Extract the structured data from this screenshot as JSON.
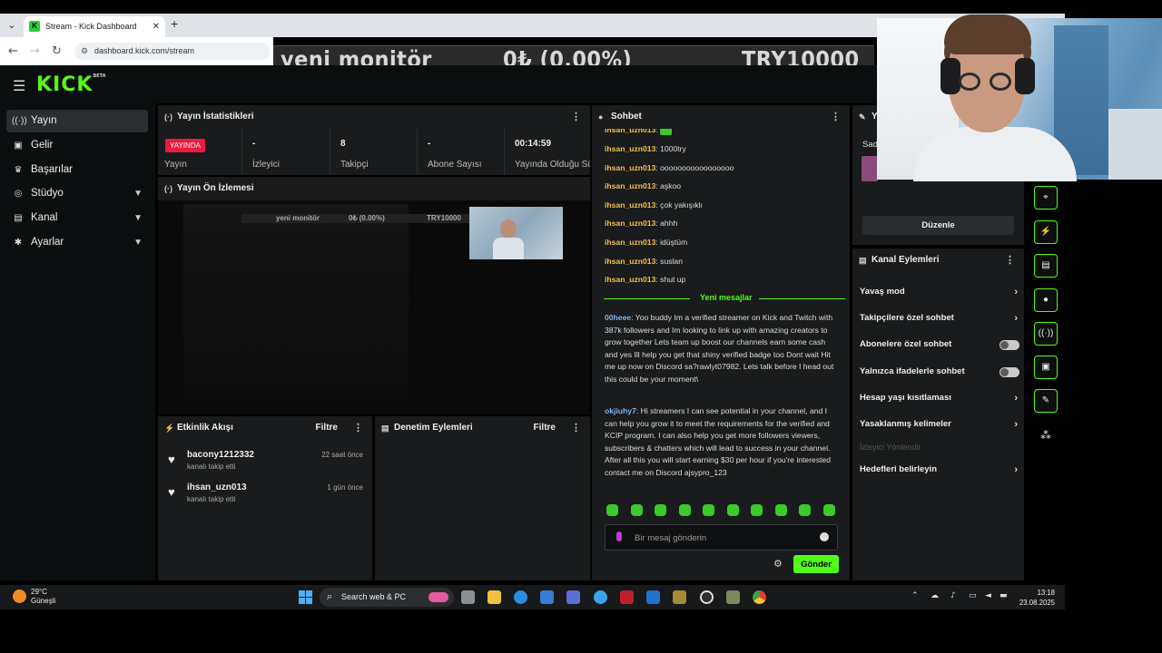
{
  "browser": {
    "tab_title": "Stream - Kick Dashboard",
    "favicon": "K",
    "url": "dashboard.kick.com/stream"
  },
  "ticker": {
    "name": "yeni monitör",
    "amount": "0₺ (0.00%)",
    "goal": "TRY10000"
  },
  "header": {
    "logo": "KICK",
    "logo_badge": "BETA"
  },
  "sidebar": {
    "items": [
      {
        "label": "Yayın",
        "icon": "broadcast-icon"
      },
      {
        "label": "Gelir",
        "icon": "wallet-icon"
      },
      {
        "label": "Başarılar",
        "icon": "trophy-icon"
      },
      {
        "label": "Stüdyo",
        "icon": "studio-icon"
      },
      {
        "label": "Kanal",
        "icon": "channel-icon"
      },
      {
        "label": "Ayarlar",
        "icon": "gear-icon"
      }
    ]
  },
  "stats": {
    "title": "Yayın İstatistikleri",
    "live_badge": "YAYINDA",
    "stream_label": "Yayın",
    "viewers_value": "-",
    "viewers_label": "İzleyici",
    "followers_value": "8",
    "followers_label": "Takipçi",
    "subs_value": "-",
    "subs_label": "Abone Sayısı",
    "duration_value": "00:14:59",
    "duration_label": "Yayında Olduğu Sü"
  },
  "preview": {
    "title": "Yayın Ön İzlemesi",
    "ticker_name": "yeni monitör",
    "ticker_amount": "0₺ (0.00%)",
    "ticker_goal": "TRY10000"
  },
  "events": {
    "title": "Etkinlik Akışı",
    "filter": "Filtre",
    "items": [
      {
        "user": "bacony1212332",
        "action": "kanalı takip etti",
        "time": "22 saat önce"
      },
      {
        "user": "ihsan_uzn013",
        "action": "kanalı takip etti",
        "time": "1 gün önce"
      }
    ]
  },
  "moderation": {
    "title": "Denetim Eylemleri",
    "filter": "Filtre"
  },
  "chat": {
    "title": "Sohbet",
    "messages": [
      {
        "user": "ihsan_uzn013",
        "text": ""
      },
      {
        "user": "ihsan_uzn013",
        "text": "1000try"
      },
      {
        "user": "ihsan_uzn013",
        "text": "ooooooooooooooooo"
      },
      {
        "user": "ihsan_uzn013",
        "text": "aşkoo"
      },
      {
        "user": "ihsan_uzn013",
        "text": "çok yakışıklı"
      },
      {
        "user": "ihsan_uzn013",
        "text": "ahhh"
      },
      {
        "user": "ihsan_uzn013",
        "text": "idüştüm"
      },
      {
        "user": "ihsan_uzn013",
        "text": "suslan"
      },
      {
        "user": "ihsan_uzn013",
        "text": "shut up"
      }
    ],
    "new_messages_label": "Yeni mesajlar",
    "new_messages": [
      {
        "user": "00heee",
        "text": "Yoo buddy Im a verified streamer on Kick and Twitch with 387k followers and Im looking to link up with amazing creators to grow together Lets team up boost our channels earn some cash and yes Ill help you get that shiny verified badge too Dont wait Hit me up now on Discord sa?rawlyt07982. Lets talk before I head out this could be your moment\\"
      },
      {
        "user": "okjiuhy7",
        "text": "Hi streamers I can see potential in your channel, and I can help you grow it to meet the requirements for the verified and KCIP program. I can also help you get more followers viewers, subscribers & chatters which will lead to success in your channel. After all this you will start earning $30 per hour if you're interested contact me on Discord ajsypro_123"
      }
    ],
    "input_placeholder": "Bir mesaj gönderin",
    "send_label": "Gönder"
  },
  "right_top": {
    "title_partial": "Y",
    "label_partial": "Sad",
    "edit_button": "Düzenle"
  },
  "channel_actions": {
    "title": "Kanal Eylemleri",
    "items": [
      {
        "label": "Yavaş mod",
        "control": "chevron"
      },
      {
        "label": "Takipçilere özel sohbet",
        "control": "chevron"
      },
      {
        "label": "Abonelere özel sohbet",
        "control": "toggle"
      },
      {
        "label": "Yalnızca ifadelerle sohbet",
        "control": "toggle"
      },
      {
        "label": "Hesap yaşı kısıtlaması",
        "control": "chevron"
      },
      {
        "label": "Yasaklanmış kelimeler",
        "control": "chevron"
      },
      {
        "label": "İzleyici Yönlendir",
        "control": "disabled"
      },
      {
        "label": "Hedefleri belirleyin",
        "control": "chevron"
      }
    ]
  },
  "taskbar": {
    "temperature": "29°C",
    "weather": "Güneşli",
    "search_placeholder": "Search web & PC",
    "time": "13:18",
    "date": "23.08.2025"
  },
  "colors": {
    "kick_green": "#53fc18",
    "live_red": "#e91c3f",
    "panel_bg": "#191b1c",
    "username_gold": "#f4c04a",
    "username_blue": "#7fb4e8"
  }
}
